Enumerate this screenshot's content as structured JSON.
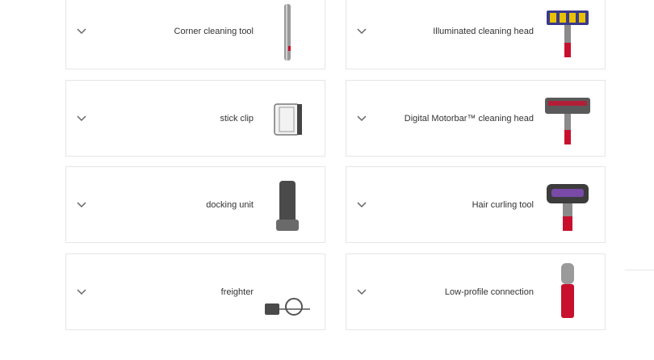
{
  "accessories": [
    {
      "label": "Corner cleaning tool",
      "icon": "corner-cleaning-tool-icon"
    },
    {
      "label": "Illuminated cleaning head",
      "icon": "illuminated-cleaning-head-icon"
    },
    {
      "label": "stick clip",
      "icon": "stick-clip-icon"
    },
    {
      "label": "Digital Motorbar™ cleaning head",
      "icon": "motorbar-cleaning-head-icon"
    },
    {
      "label": "docking unit",
      "icon": "docking-unit-icon"
    },
    {
      "label": "Hair curling tool",
      "icon": "hair-curling-tool-icon"
    },
    {
      "label": "freighter",
      "icon": "charger-icon"
    },
    {
      "label": "Low-profile connection",
      "icon": "low-profile-connection-icon"
    }
  ],
  "colors": {
    "border": "#e6e6e6",
    "text": "#333333",
    "accent_red": "#c8102e",
    "metal": "#8a8a8a"
  }
}
